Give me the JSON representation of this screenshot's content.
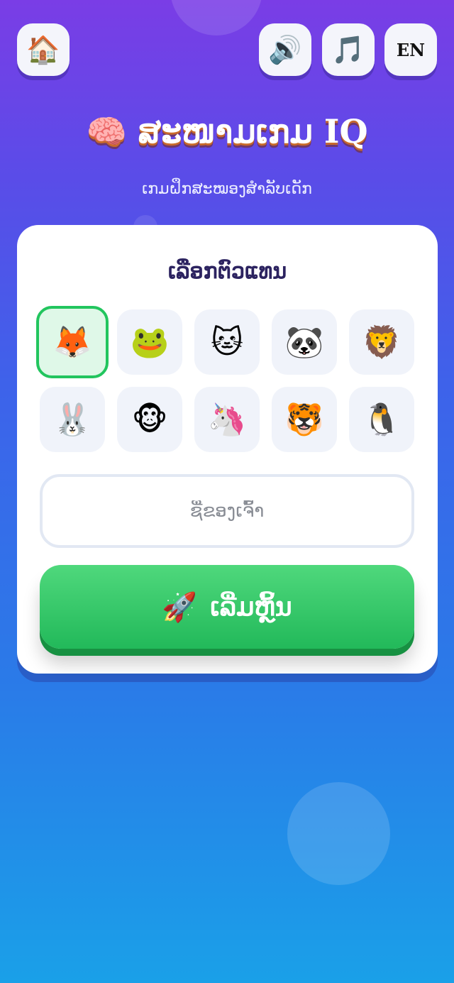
{
  "topbar": {
    "home_icon": "house-icon",
    "sound_icon": "speaker-icon",
    "music_icon": "music-note-icon",
    "language_label": "EN",
    "home_glyph": "🏠",
    "sound_glyph": "🔊",
    "music_glyph": "🎵"
  },
  "header": {
    "title_icon": "brain-icon",
    "title_glyph": "🧠",
    "title": "ສະໜາມເກມ IQ",
    "subtitle": "ເກມຝຶກສະໝອງສຳລັບເດັກ"
  },
  "card": {
    "heading": "ເລືອກຕົວແທນ",
    "avatars": [
      {
        "name": "fox",
        "glyph": "🦊",
        "selected": true
      },
      {
        "name": "frog",
        "glyph": "🐸",
        "selected": false
      },
      {
        "name": "cat",
        "glyph": "🐱",
        "selected": false
      },
      {
        "name": "panda",
        "glyph": "🐼",
        "selected": false
      },
      {
        "name": "lion",
        "glyph": "🦁",
        "selected": false
      },
      {
        "name": "rabbit",
        "glyph": "🐰",
        "selected": false
      },
      {
        "name": "monkey",
        "glyph": "🐵",
        "selected": false
      },
      {
        "name": "unicorn",
        "glyph": "🦄",
        "selected": false
      },
      {
        "name": "tiger",
        "glyph": "🐯",
        "selected": false
      },
      {
        "name": "penguin",
        "glyph": "🐧",
        "selected": false
      }
    ],
    "name_input": {
      "placeholder": "ຊື່ຂອງເຈົ້າ",
      "value": ""
    },
    "start_button": {
      "icon": "rocket-icon",
      "glyph": "🚀",
      "label": "ເລີ່ມຫຼິ້ນ"
    }
  },
  "colors": {
    "accent_green": "#22c55e",
    "background_top": "#7a3de6",
    "background_bottom": "#1aa0e8",
    "heading_text": "#2c2360"
  }
}
